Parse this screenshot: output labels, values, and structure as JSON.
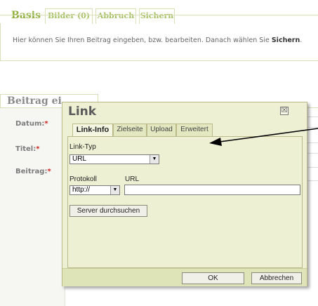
{
  "top_tabs": [
    {
      "label": "Basis"
    },
    {
      "label": "Bilder (0)"
    },
    {
      "label": "Abbruch"
    },
    {
      "label": "Sichern"
    }
  ],
  "info": {
    "text_before": "Hier können Sie Ihren Beitrag eingeben, bzw. bearbeiten. Danach wählen Sie ",
    "text_bold": "Sichern",
    "text_after": "."
  },
  "form": {
    "title": "Beitrag ei",
    "labels": [
      "Datum:",
      "Titel:",
      "Beitrag:"
    ],
    "required_mark": "*"
  },
  "dialog": {
    "title": "Link",
    "close_glyph": "☒",
    "tabs": [
      "Link-Info",
      "Zielseite",
      "Upload",
      "Erweitert"
    ],
    "link_type_label": "Link-Typ",
    "link_type_value": "URL",
    "protocol_label": "Protokoll",
    "protocol_value": "http://",
    "url_label": "URL",
    "url_value": "",
    "browse_button": "Server durchsuchen",
    "ok_button": "OK",
    "cancel_button": "Abbrechen"
  },
  "colors": {
    "accent_green": "#90b040",
    "dialog_bg": "#eef0d4",
    "required": "#cc2222",
    "annotation_arrow": "#000000"
  }
}
